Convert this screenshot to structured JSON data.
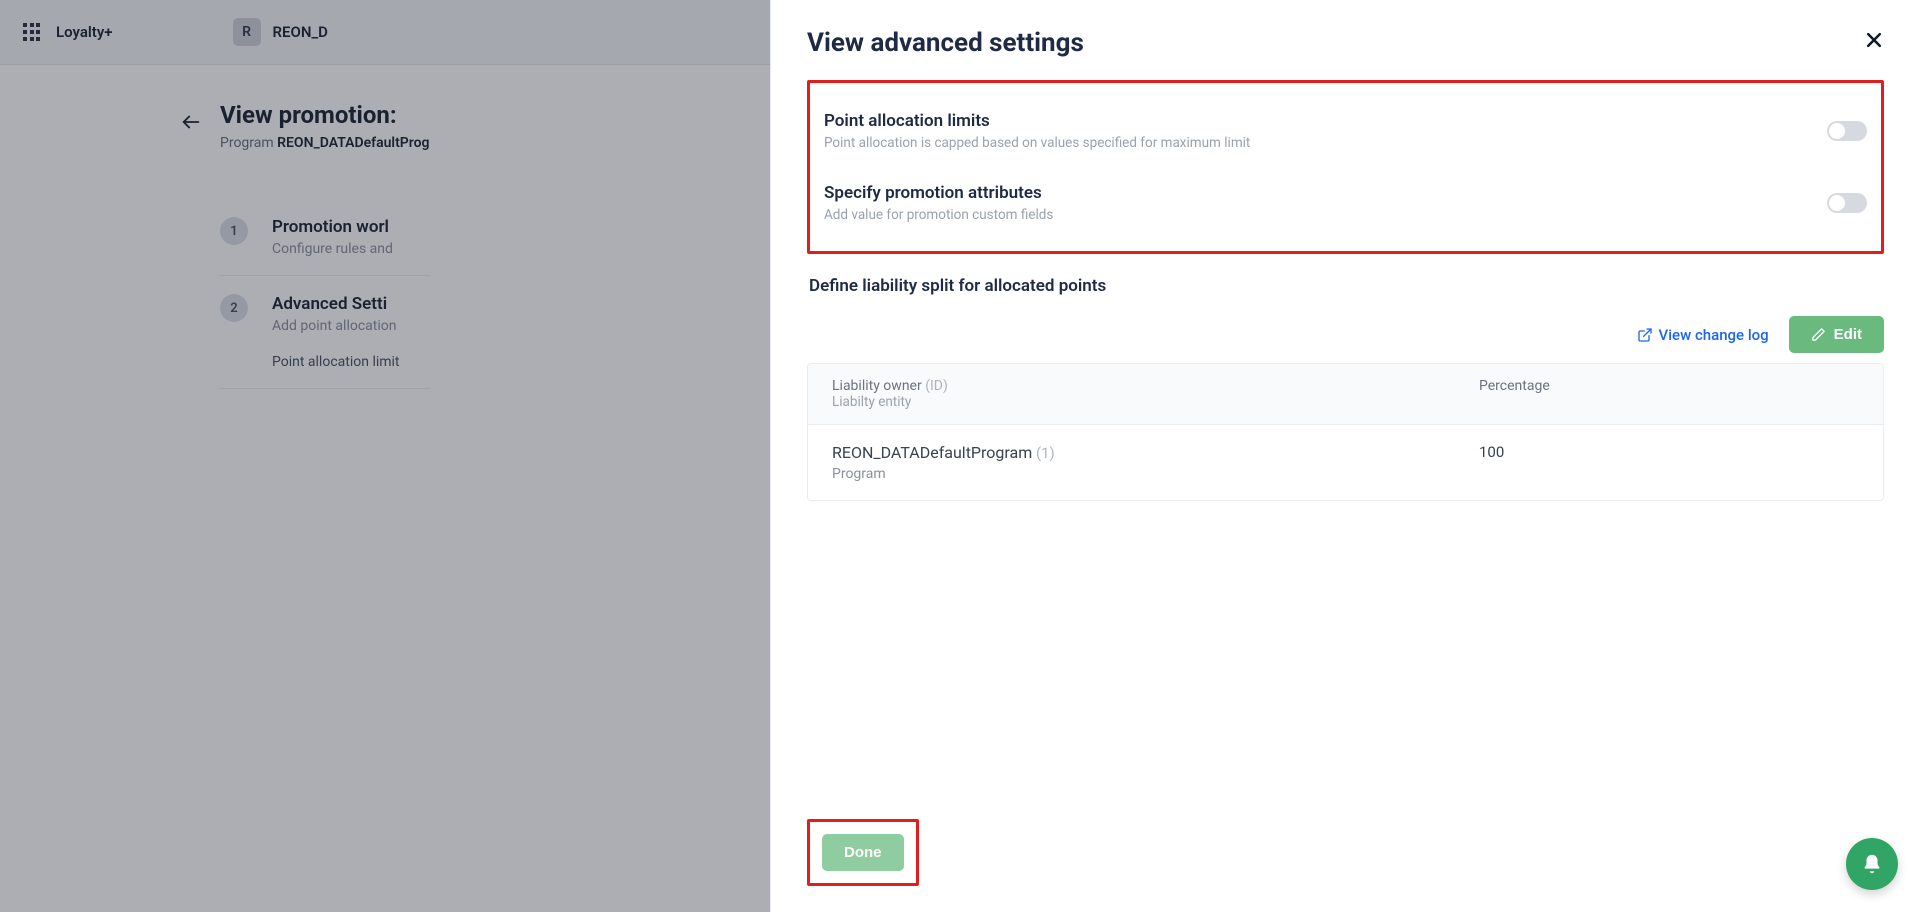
{
  "header": {
    "brand": "Loyalty+",
    "org_initial": "R",
    "org_name": "REON_D"
  },
  "page": {
    "title": "View promotion:",
    "program_label": "Program",
    "program_name": "REON_DATADefaultProg",
    "steps": [
      {
        "num": "1",
        "title": "Promotion worl",
        "sub": "Configure rules and "
      },
      {
        "num": "2",
        "title": "Advanced Setti",
        "sub": "Add point allocation",
        "extra": "Point allocation limit"
      }
    ]
  },
  "modal": {
    "title": "View advanced settings",
    "settings": [
      {
        "title": "Point allocation limits",
        "desc": "Point allocation is capped based on values specified for maximum limit"
      },
      {
        "title": "Specify promotion attributes",
        "desc": "Add value for promotion custom fields"
      }
    ],
    "section_title": "Define liability split for allocated points",
    "change_log_label": "View change log",
    "edit_label": "Edit",
    "table": {
      "header_owner": "Liability owner",
      "header_owner_id": "(ID)",
      "header_entity": "Liabilty entity",
      "header_pct": "Percentage",
      "rows": [
        {
          "name": "REON_DATADefaultProgram",
          "id": "(1)",
          "entity": "Program",
          "pct": "100"
        }
      ]
    },
    "done_label": "Done"
  }
}
